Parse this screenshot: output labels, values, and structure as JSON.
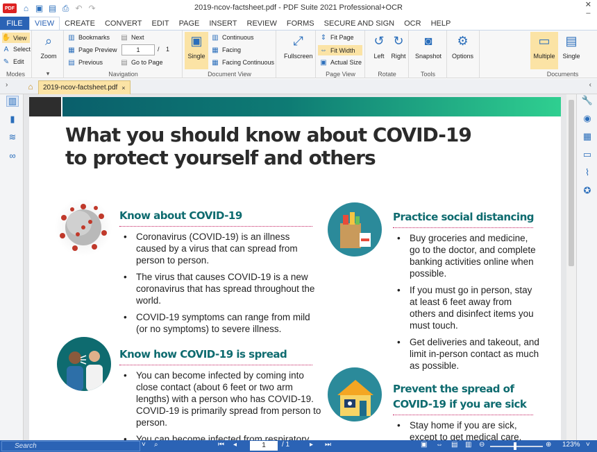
{
  "titlebar": {
    "title": "2019-ncov-factsheet.pdf  -  PDF Suite 2021  Professional+OCR",
    "app_badge": "PDF",
    "minimize": "–",
    "close": "✕"
  },
  "menu": [
    "FILE",
    "VIEW",
    "CREATE",
    "CONVERT",
    "EDIT",
    "PAGE",
    "INSERT",
    "REVIEW",
    "FORMS",
    "SECURE AND SIGN",
    "OCR",
    "HELP"
  ],
  "ribbon": {
    "modes": {
      "label": "Modes",
      "view": "View",
      "select": "Select",
      "edit": "Edit"
    },
    "zoom": "Zoom",
    "navigation": {
      "label": "Navigation",
      "bookmarks": "Bookmarks",
      "page_preview": "Page Preview",
      "previous": "Previous",
      "next": "Next",
      "go_to_page": "Go to Page",
      "page_value": "1",
      "page_sep": "/",
      "page_total": "1"
    },
    "document_view": {
      "label": "Document View",
      "single": "Single",
      "continuous": "Continuous",
      "facing": "Facing",
      "facing_continuous": "Facing Continuous"
    },
    "fullscreen": "Fullscreen",
    "page_view": {
      "label": "Page View",
      "fit_page": "Fit Page",
      "fit_width": "Fit Width",
      "actual_size": "Actual Size"
    },
    "rotate": {
      "label": "Rotate",
      "left": "Left",
      "right": "Right"
    },
    "tools": {
      "label": "Tools",
      "snapshot": "Snapshot"
    },
    "options": "Options",
    "documents": {
      "label": "Documents",
      "multiple": "Multiple",
      "single": "Single"
    }
  },
  "tab": {
    "name": "2019-ncov-factsheet.pdf",
    "close": "×"
  },
  "pdf": {
    "title_line1": "What you should know about COVID-19",
    "title_line2": "to protect yourself and others",
    "left": [
      {
        "heading": "Know about COVID-19",
        "bullets": [
          "Coronavirus (COVID-19) is an illness caused by a virus that can spread from person to person.",
          "The virus that causes COVID-19 is a new coronavirus that has spread throughout the world.",
          "COVID-19 symptoms can range from mild (or no symptoms) to severe illness."
        ]
      },
      {
        "heading": "Know how COVID-19 is spread",
        "bullets": [
          "You can become infected by coming into close contact (about 6 feet or two arm lengths) with a person who has COVID-19. COVID-19 is primarily spread from person to person.",
          "You can become infected from respiratory"
        ]
      }
    ],
    "right": [
      {
        "heading": "Practice social distancing",
        "bullets": [
          "Buy groceries and medicine, go to the doctor, and complete banking activities online when possible.",
          "If you must go in person, stay at least 6 feet away from others and disinfect items you must touch.",
          "Get deliveries and takeout, and limit in-person contact as much as possible."
        ]
      },
      {
        "heading_line1": "Prevent the spread of",
        "heading_line2": "COVID-19 if you are sick",
        "bullets": [
          "Stay home if you are sick, except to get medical care."
        ]
      }
    ]
  },
  "statusbar": {
    "search_placeholder": "Search",
    "page_value": "1",
    "page_total": "/ 1",
    "zoom": "123%"
  },
  "colors": {
    "accent": "#2b63b5",
    "highlight": "#fbe3a5",
    "teal": "#0e6b6f"
  }
}
